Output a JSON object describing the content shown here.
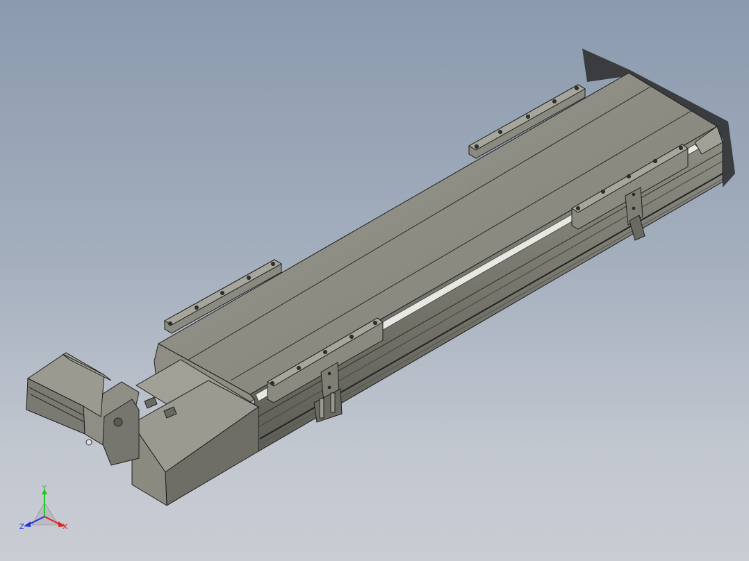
{
  "viewport": {
    "background_top": "#8b9aae",
    "background_bottom": "#c9ccd3"
  },
  "model": {
    "body_color": "#8c8c82",
    "edge_color": "#1e1e1e"
  },
  "triad": {
    "y_label": "Y",
    "x_label": "X",
    "z_label": "Z",
    "y_color": "#19c81e",
    "x_color": "#e0201c",
    "z_color": "#2030e0"
  }
}
